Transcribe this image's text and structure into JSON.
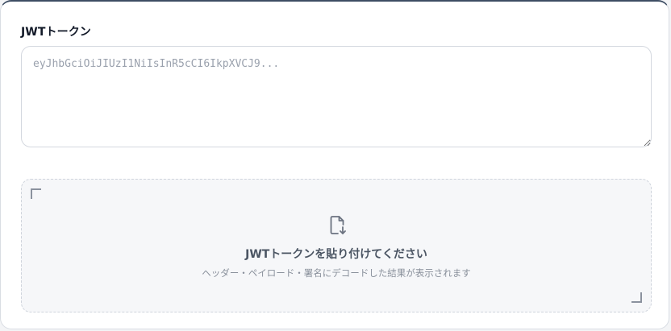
{
  "form": {
    "token_label": "JWTトークン",
    "token_placeholder": "eyJhbGciOiJIUzI1NiIsInR5cCI6IkpXVCJ9...",
    "token_value": ""
  },
  "drop_zone": {
    "icon": "file-import-icon",
    "title": "JWTトークンを貼り付けてください",
    "subtitle": "ヘッダー・ペイロード・署名にデコードした結果が表示されます"
  },
  "colors": {
    "card_top_border": "#3d4d63",
    "label_text": "#111827",
    "drop_zone_bg": "#f6f7f9"
  }
}
